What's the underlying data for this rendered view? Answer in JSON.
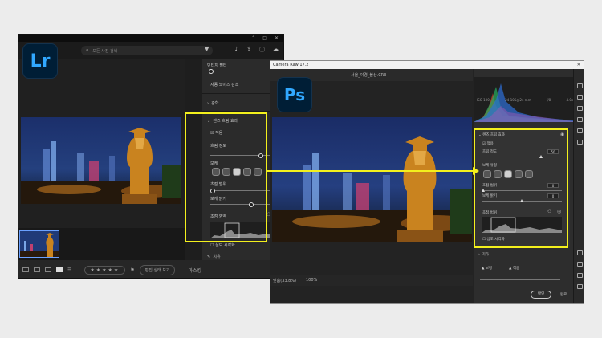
{
  "lightroom": {
    "logo_text": "Lr",
    "window_controls": [
      "⌃",
      "□",
      "✕"
    ],
    "search_placeholder": "모든 사진 검색",
    "panel": {
      "top_label": "빈티지 필터",
      "auto_remove_label": "자동 노이즈 감소",
      "section_optics": "광학",
      "section_lens_blur": "렌즈 흐림 효과",
      "apply_label": "적용",
      "blur_amount_label": "흐림 정도",
      "blur_amount_value": "50",
      "bokeh_label": "보케",
      "focal_range_label": "초점 범위",
      "brightness_label": "보케 밝기",
      "brightness_value": "0",
      "visualize_label": "초점 범위",
      "focus_area_label": "초점 영역",
      "visualize_depth_label": "심도 시각화",
      "section_healing": "치유",
      "section_masking": "마스킹"
    },
    "bottom": {
      "stars": "★★★★★",
      "button_label": "편집 상태 보기"
    }
  },
  "camera_raw": {
    "title": "Camera Raw 17.2",
    "logo_text": "Ps",
    "filename": "서울_야경_불상.CR3",
    "histogram_labels": [
      "ISO 100",
      "24-105@24 mm",
      "f/8",
      "4.0s"
    ],
    "panel": {
      "section_lens_blur": "렌즈 흐림 효과",
      "apply_label": "적용",
      "blur_amount_label": "흐림 정도",
      "blur_amount_value": "50",
      "bokeh_label": "보케 유형",
      "brightness_label": "보케 밝기",
      "brightness_value": "0",
      "focal_label": "초점 범위",
      "focal_value": "0",
      "focus_area_label": "초점 범위",
      "visualize_depth_label": "심도 시각화",
      "section_below": "기타",
      "sub_left": "보정",
      "sub_right": "적용"
    },
    "bottom": {
      "zoom_fit": "맞춤(33.8%)",
      "zoom_100": "100%"
    },
    "ok_label": "확인",
    "done_label": "완료"
  },
  "colors": {
    "highlight": "#f3f01d",
    "adobe_blue": "#31a8ff",
    "adobe_navy": "#001e36"
  }
}
